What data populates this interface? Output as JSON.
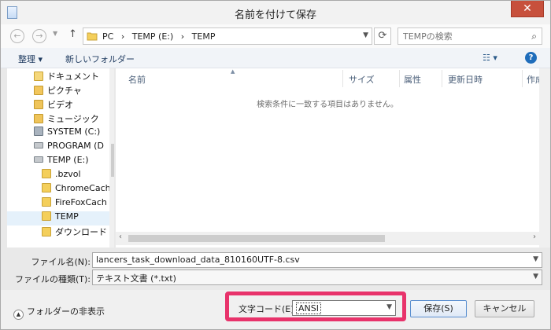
{
  "window": {
    "title": "名前を付けて保存",
    "close_label": "✕"
  },
  "address": {
    "crumbs": [
      "PC",
      "›",
      "TEMP (E:)",
      "›",
      "TEMP"
    ],
    "search_placeholder": "TEMPの検索"
  },
  "toolbar": {
    "organize_label": "整理 ▾",
    "new_folder_label": "新しいフォルダー",
    "help_label": "?"
  },
  "nav": {
    "items": [
      {
        "label": "ドキュメント",
        "icon": "documents-icon"
      },
      {
        "label": "ピクチャ",
        "icon": "pictures-icon"
      },
      {
        "label": "ビデオ",
        "icon": "videos-icon"
      },
      {
        "label": "ミュージック",
        "icon": "music-icon"
      },
      {
        "label": "SYSTEM (C:)",
        "icon": "system-drive-icon"
      },
      {
        "label": "PROGRAM (D",
        "icon": "drive-icon"
      },
      {
        "label": "TEMP (E:)",
        "icon": "drive-icon"
      },
      {
        "label": ".bzvol",
        "icon": "folder-icon"
      },
      {
        "label": "ChromeCach",
        "icon": "folder-icon"
      },
      {
        "label": "FireFoxCach",
        "icon": "folder-icon"
      },
      {
        "label": "TEMP",
        "icon": "folder-icon",
        "selected": true
      },
      {
        "label": "ダウンロード",
        "icon": "downloads-icon"
      }
    ]
  },
  "files": {
    "columns": [
      "名前",
      "サイズ",
      "属性",
      "更新日時",
      "作成"
    ],
    "empty_message": "検索条件に一致する項目はありません。"
  },
  "form": {
    "filename_label": "ファイル名(N):",
    "filename_value": "lancers_task_download_data_810160UTF-8.csv",
    "filetype_label": "ファイルの種類(T):",
    "filetype_value": "テキスト文書 (*.txt)"
  },
  "bottom": {
    "hide_folders_label": "フォルダーの非表示",
    "encoding_label": "文字コード(E):",
    "encoding_value": "ANSI",
    "save_label": "保存(S)",
    "cancel_label": "キャンセル"
  },
  "colors": {
    "highlight": "#e8336b",
    "close": "#c7503c",
    "accent": "#1f6dbb"
  }
}
